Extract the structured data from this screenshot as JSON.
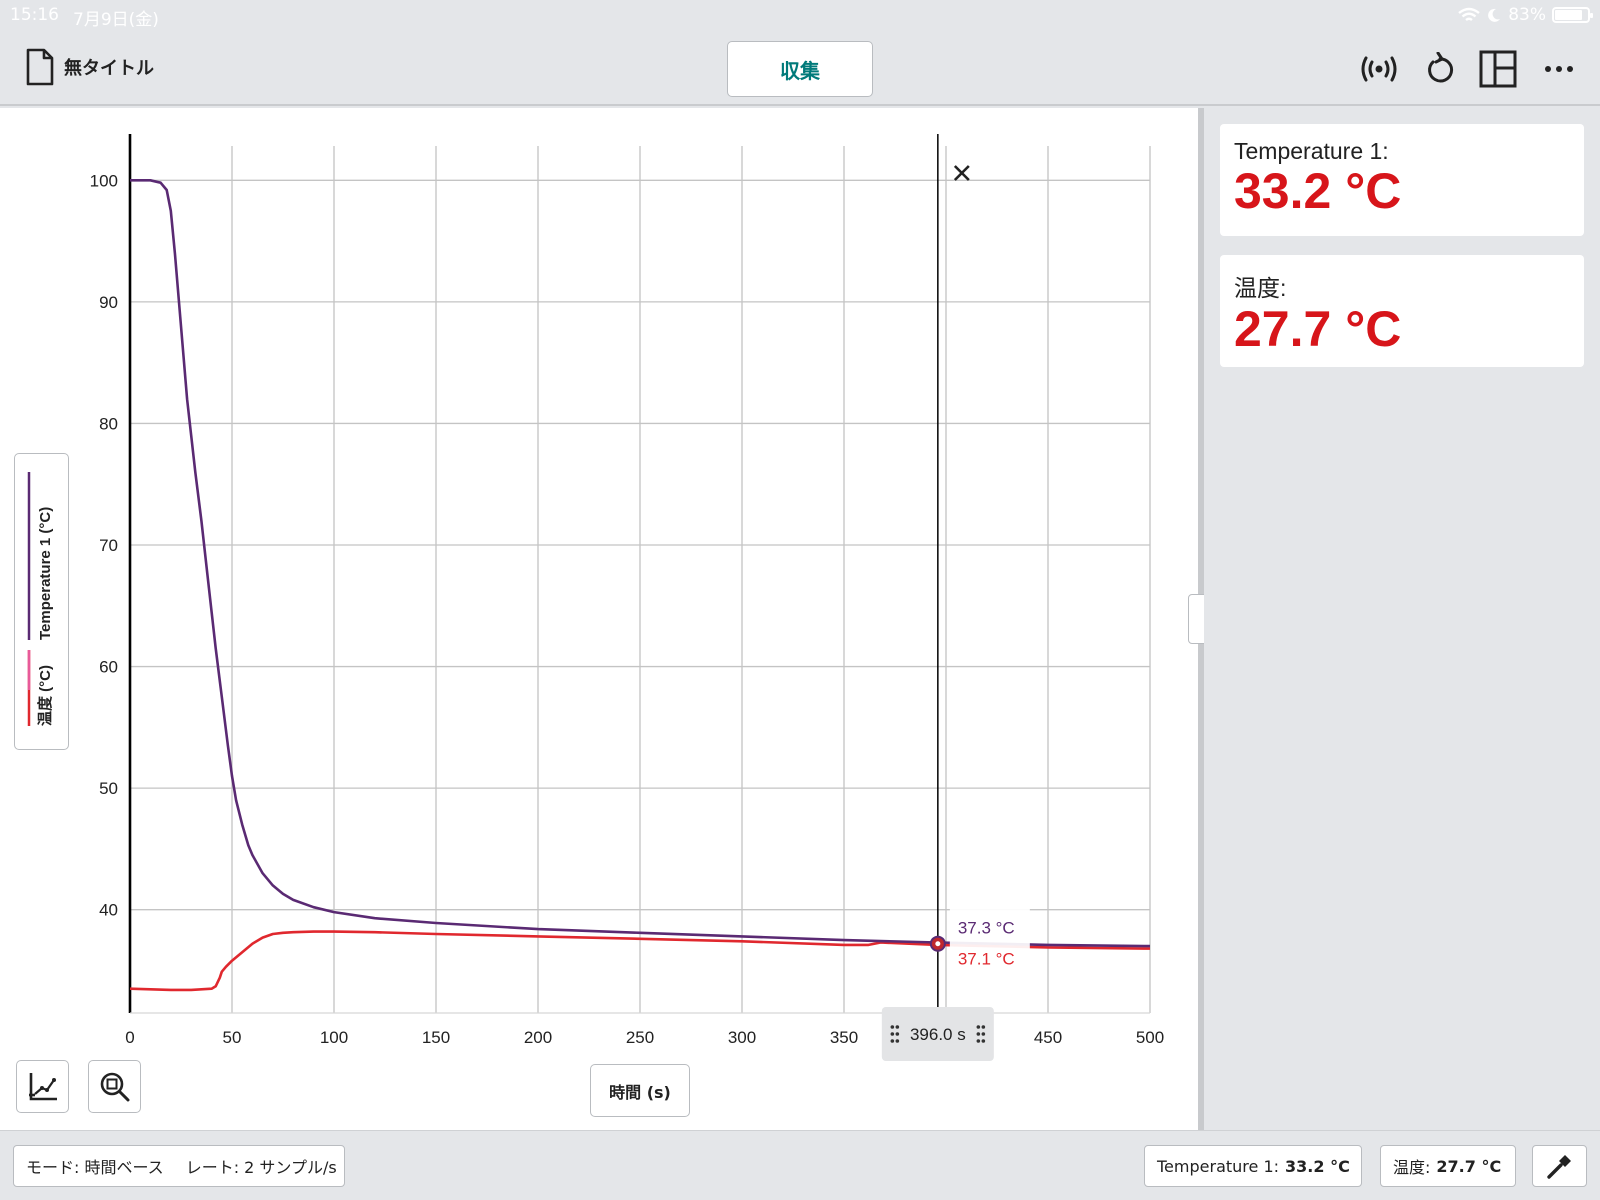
{
  "status_bar": {
    "time": "15:16",
    "date": "7月9日(金)",
    "battery": "83%"
  },
  "toolbar": {
    "doc_title": "無タイトル",
    "collect_label": "収集",
    "icons": [
      "document-icon",
      "sensor-broadcast-icon",
      "reset-icon",
      "layout-icon",
      "more-icon"
    ]
  },
  "meters": [
    {
      "label": "Temperature 1:",
      "value": "33.2 °C"
    },
    {
      "label": "温度:",
      "value": "27.7 °C"
    }
  ],
  "footer": {
    "mode": "モード: 時間ベース",
    "rate": "レート: 2 サンプル/s",
    "readout1_label": "Temperature 1:",
    "readout1_value": "33.2 °C",
    "readout2_label": "温度:",
    "readout2_value": "27.7 °C"
  },
  "graph": {
    "legend_series1": "Temperature 1 (°C)",
    "legend_series2": "温度 (°C)",
    "xaxis_button": "時間 (s)",
    "cursor_label": "396.0 s",
    "cursor_value1": "37.3 °C",
    "cursor_value2": "37.1 °C"
  },
  "colors": {
    "series1": "#5a2a73",
    "series2": "#e0282e",
    "meter_value": "#d7151a",
    "accent": "#007a7a"
  },
  "chart_data": {
    "type": "line",
    "xlim": [
      0,
      500
    ],
    "ylim": [
      31.5,
      102
    ],
    "xticks": [
      0,
      50,
      100,
      150,
      200,
      250,
      300,
      350,
      400,
      450,
      500
    ],
    "xtick_labels": [
      "0",
      "50",
      "100",
      "150",
      "200",
      "250",
      "300",
      "350",
      "400",
      "450",
      "500"
    ],
    "yticks": [
      40,
      50,
      60,
      70,
      80,
      90,
      100
    ],
    "ytick_labels": [
      "40",
      "50",
      "60",
      "70",
      "80",
      "90",
      "100"
    ],
    "grid": true,
    "cursor_x": 396,
    "series": [
      {
        "name": "Temperature 1 (°C)",
        "x": [
          0,
          10,
          15,
          18,
          20,
          22,
          25,
          28,
          30,
          32,
          35,
          38,
          40,
          42,
          45,
          48,
          50,
          52,
          55,
          58,
          60,
          65,
          70,
          75,
          80,
          90,
          100,
          120,
          150,
          200,
          250,
          300,
          350,
          396,
          450,
          500
        ],
        "y": [
          100,
          100,
          99.8,
          99.2,
          97.5,
          94,
          88,
          82,
          79,
          76,
          72,
          67.5,
          64.5,
          61.5,
          57.5,
          53.5,
          51,
          49,
          47,
          45.3,
          44.5,
          43,
          42,
          41.3,
          40.8,
          40.2,
          39.8,
          39.3,
          38.9,
          38.4,
          38.1,
          37.8,
          37.5,
          37.3,
          37.1,
          37.0
        ]
      },
      {
        "name": "温度 (°C)",
        "x": [
          0,
          20,
          30,
          40,
          42,
          44,
          45,
          47,
          50,
          55,
          60,
          65,
          70,
          75,
          80,
          90,
          100,
          120,
          150,
          200,
          250,
          300,
          350,
          362,
          368,
          396,
          450,
          500
        ],
        "y": [
          33.5,
          33.4,
          33.4,
          33.5,
          33.7,
          34.4,
          34.9,
          35.3,
          35.8,
          36.5,
          37.2,
          37.7,
          38.0,
          38.1,
          38.15,
          38.2,
          38.2,
          38.15,
          38.0,
          37.8,
          37.6,
          37.4,
          37.1,
          37.1,
          37.3,
          37.1,
          36.9,
          36.8
        ]
      }
    ]
  }
}
